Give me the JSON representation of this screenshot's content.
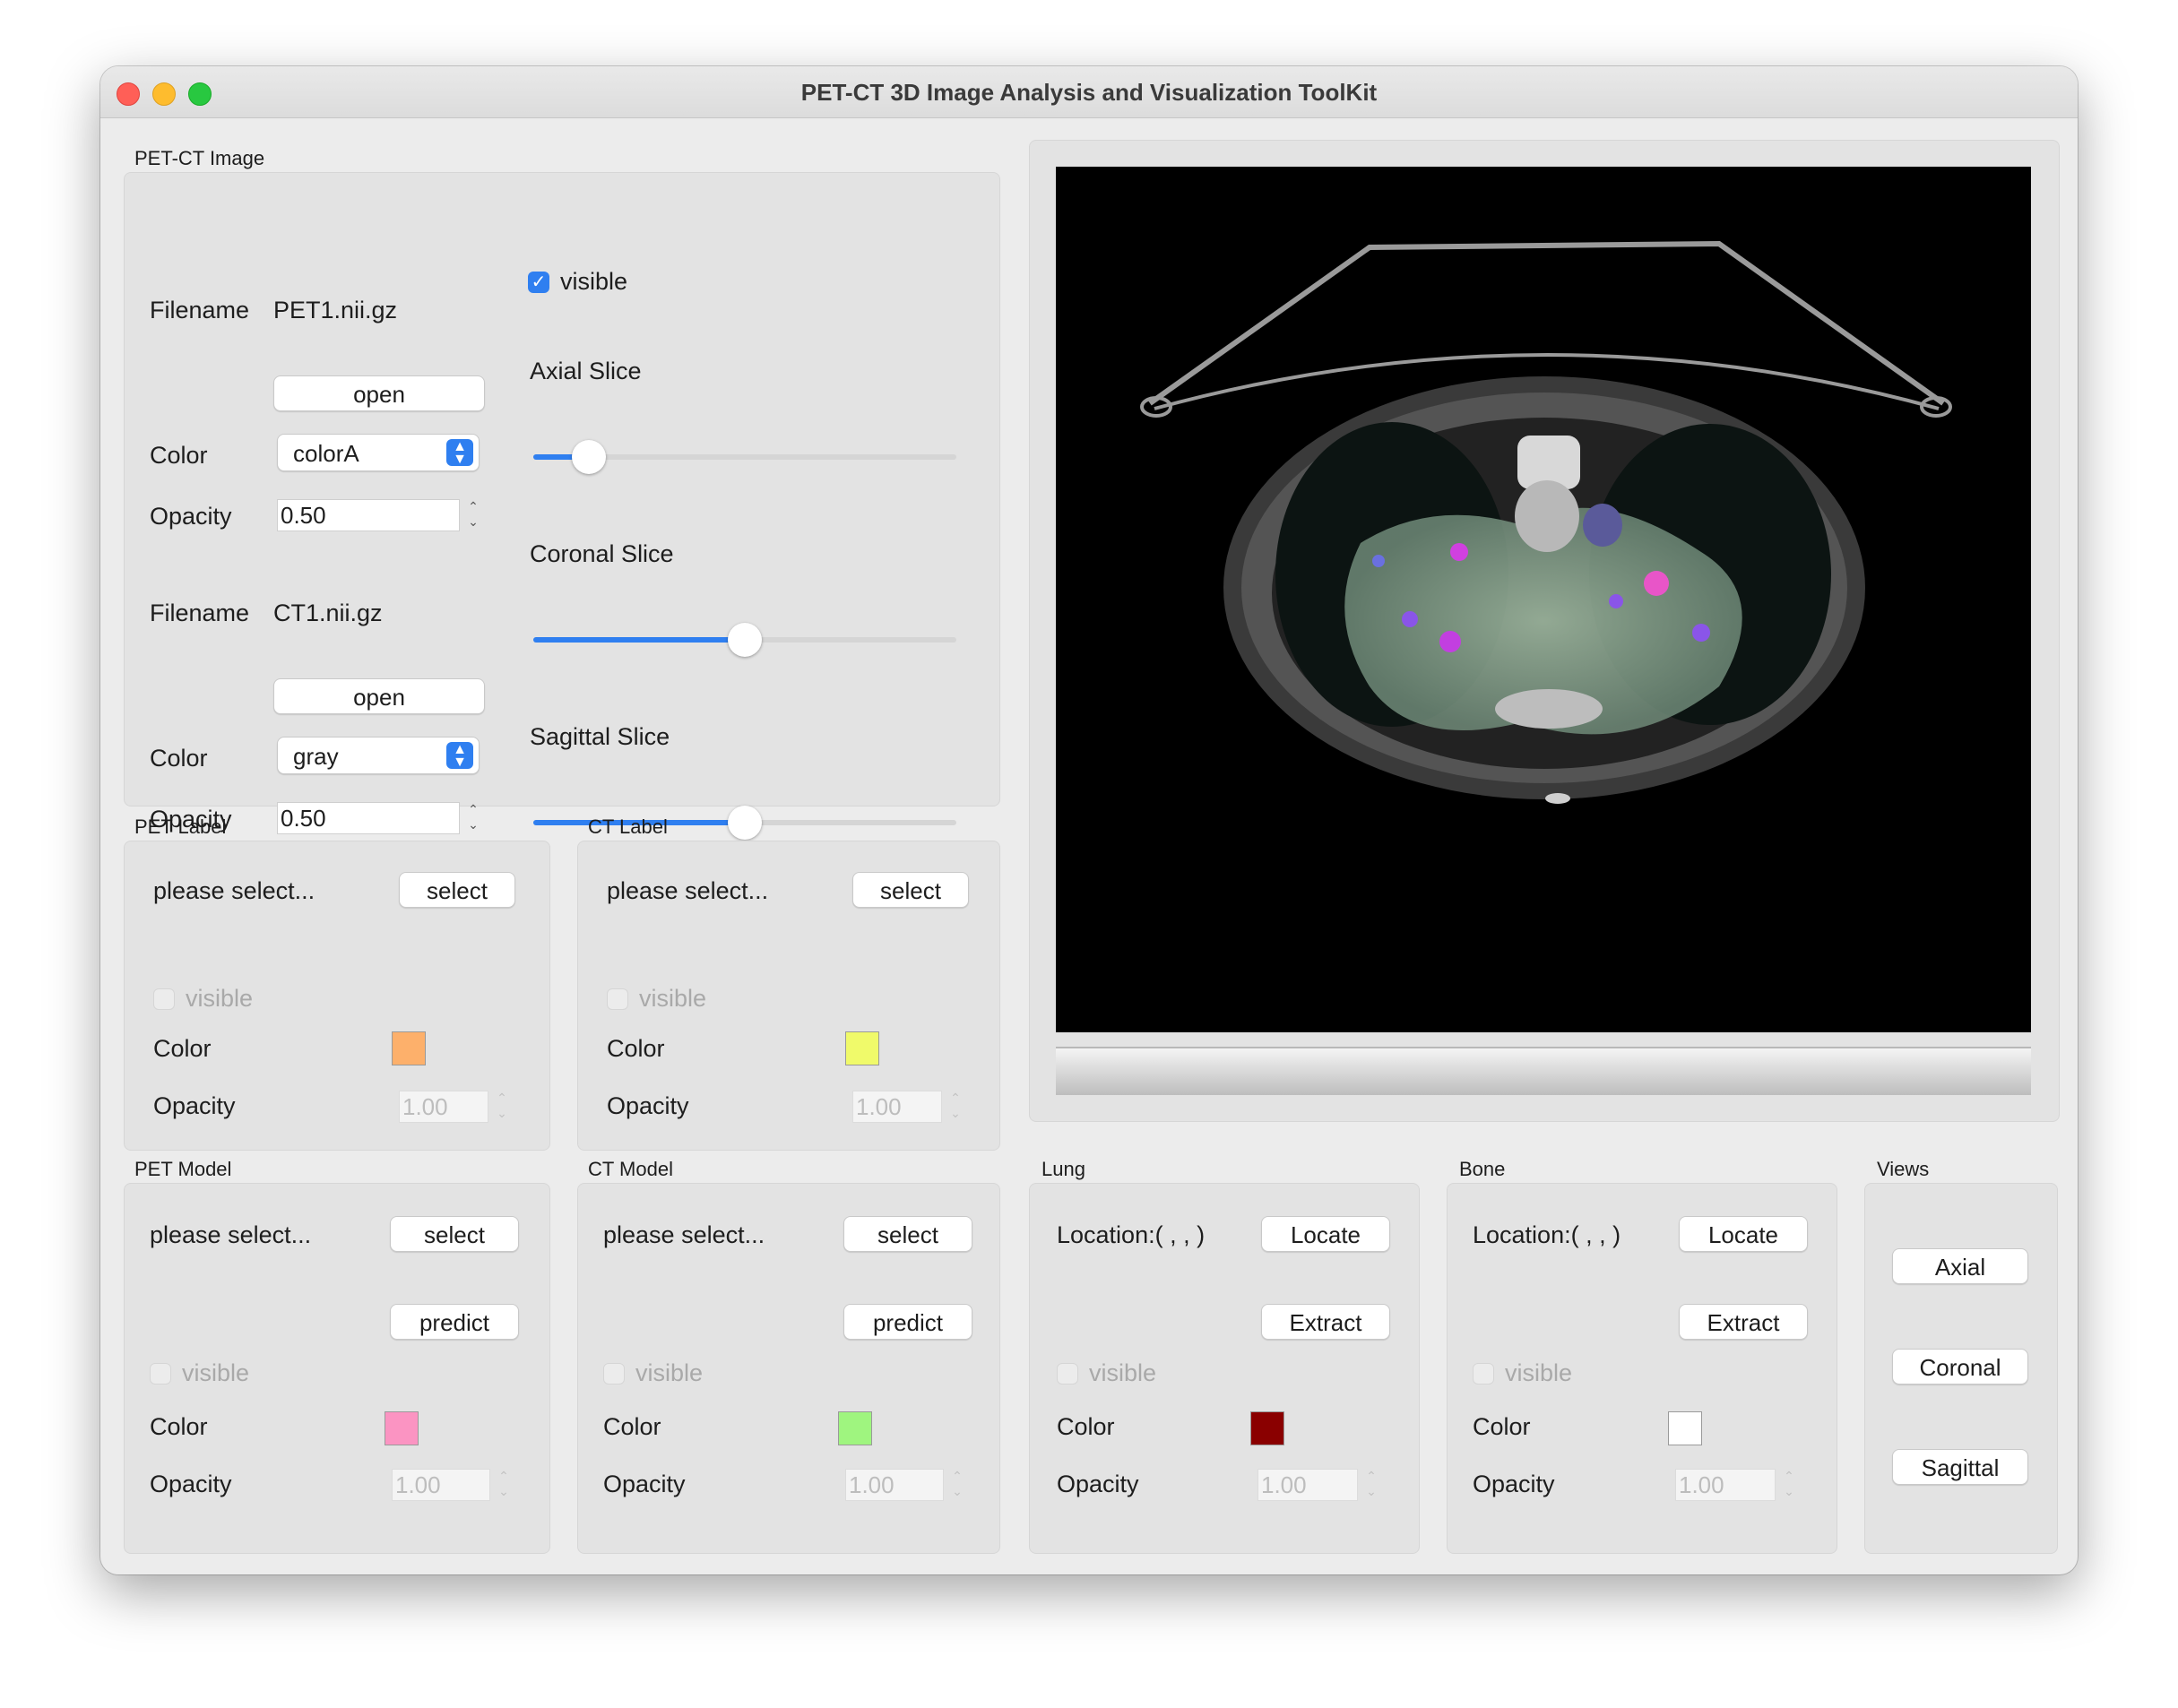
{
  "window": {
    "title": "PET-CT 3D Image Analysis and Visualization ToolKit"
  },
  "petct": {
    "title": "PET-CT Image",
    "filename_label": "Filename",
    "pet_filename": "PET1.nii.gz",
    "ct_filename": "CT1.nii.gz",
    "open_label": "open",
    "color_label": "Color",
    "pet_color": "colorA",
    "ct_color": "gray",
    "opacity_label": "Opacity",
    "pet_opacity": "0.50",
    "ct_opacity": "0.50",
    "visible_label": "visible",
    "visible_checked": true,
    "axial_label": "Axial Slice",
    "coronal_label": "Coronal Slice",
    "sagittal_label": "Sagittal Slice",
    "axial_value_fraction": 0.1,
    "coronal_value_fraction": 0.5,
    "sagittal_value_fraction": 0.5
  },
  "pet_label": {
    "title": "PET Label",
    "status": "please select...",
    "select_label": "select",
    "visible_label": "visible",
    "color_label": "Color",
    "color": "#fdb06b",
    "opacity_label": "Opacity",
    "opacity": "1.00"
  },
  "ct_label": {
    "title": "CT Label",
    "status": "please select...",
    "select_label": "select",
    "visible_label": "visible",
    "color_label": "Color",
    "color": "#f0fa6a",
    "opacity_label": "Opacity",
    "opacity": "1.00"
  },
  "pet_model": {
    "title": "PET Model",
    "status": "please select...",
    "select_label": "select",
    "predict_label": "predict",
    "visible_label": "visible",
    "color_label": "Color",
    "color": "#fb94c2",
    "opacity_label": "Opacity",
    "opacity": "1.00"
  },
  "ct_model": {
    "title": "CT Model",
    "status": "please select...",
    "select_label": "select",
    "predict_label": "predict",
    "visible_label": "visible",
    "color_label": "Color",
    "color": "#9ff57f",
    "opacity_label": "Opacity",
    "opacity": "1.00"
  },
  "lung": {
    "title": "Lung",
    "location": "Location:(  ,  ,  )",
    "locate_label": "Locate",
    "extract_label": "Extract",
    "visible_label": "visible",
    "color_label": "Color",
    "color": "#8a0000",
    "opacity_label": "Opacity",
    "opacity": "1.00"
  },
  "bone": {
    "title": "Bone",
    "location": "Location:(  ,  ,  )",
    "locate_label": "Locate",
    "extract_label": "Extract",
    "visible_label": "visible",
    "color_label": "Color",
    "color": "#ffffff",
    "opacity_label": "Opacity",
    "opacity": "1.00"
  },
  "views": {
    "title": "Views",
    "axial": "Axial",
    "coronal": "Coronal",
    "sagittal": "Sagittal"
  },
  "icons": {
    "checkbox": "checkmark-icon",
    "combo": "updown-chevron-icon",
    "spin": "stepper-arrows-icon"
  }
}
